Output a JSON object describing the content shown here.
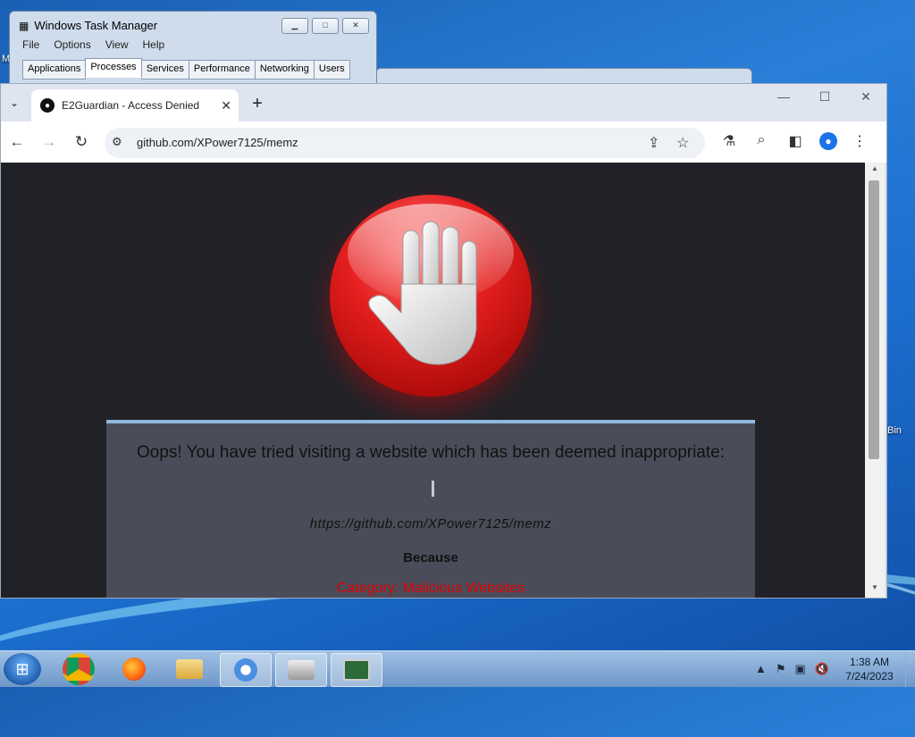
{
  "desktop": {
    "left_label": "M",
    "right_label": "Bin"
  },
  "task_manager": {
    "title": "Windows Task Manager",
    "menu": [
      "File",
      "Options",
      "View",
      "Help"
    ],
    "tabs": [
      "Applications",
      "Processes",
      "Services",
      "Performance",
      "Networking",
      "Users"
    ],
    "active_tab": "Processes"
  },
  "browser": {
    "tab_title": "E2Guardian - Access Denied",
    "url": "github.com/XPower7125/memz"
  },
  "page": {
    "headline": "Oops! You have tried visiting a website which has been deemed inappropriate:",
    "blocked_url": "https://github.com/XPower7125/memz",
    "because": "Because",
    "category": "Category: Malicious Websites"
  },
  "taskbar": {
    "time": "1:38 AM",
    "date": "7/24/2023"
  },
  "colors": {
    "stop_red": "#e51f1f",
    "category_red": "#e00000",
    "page_bg": "#202228",
    "message_bg": "#4a4d59"
  }
}
